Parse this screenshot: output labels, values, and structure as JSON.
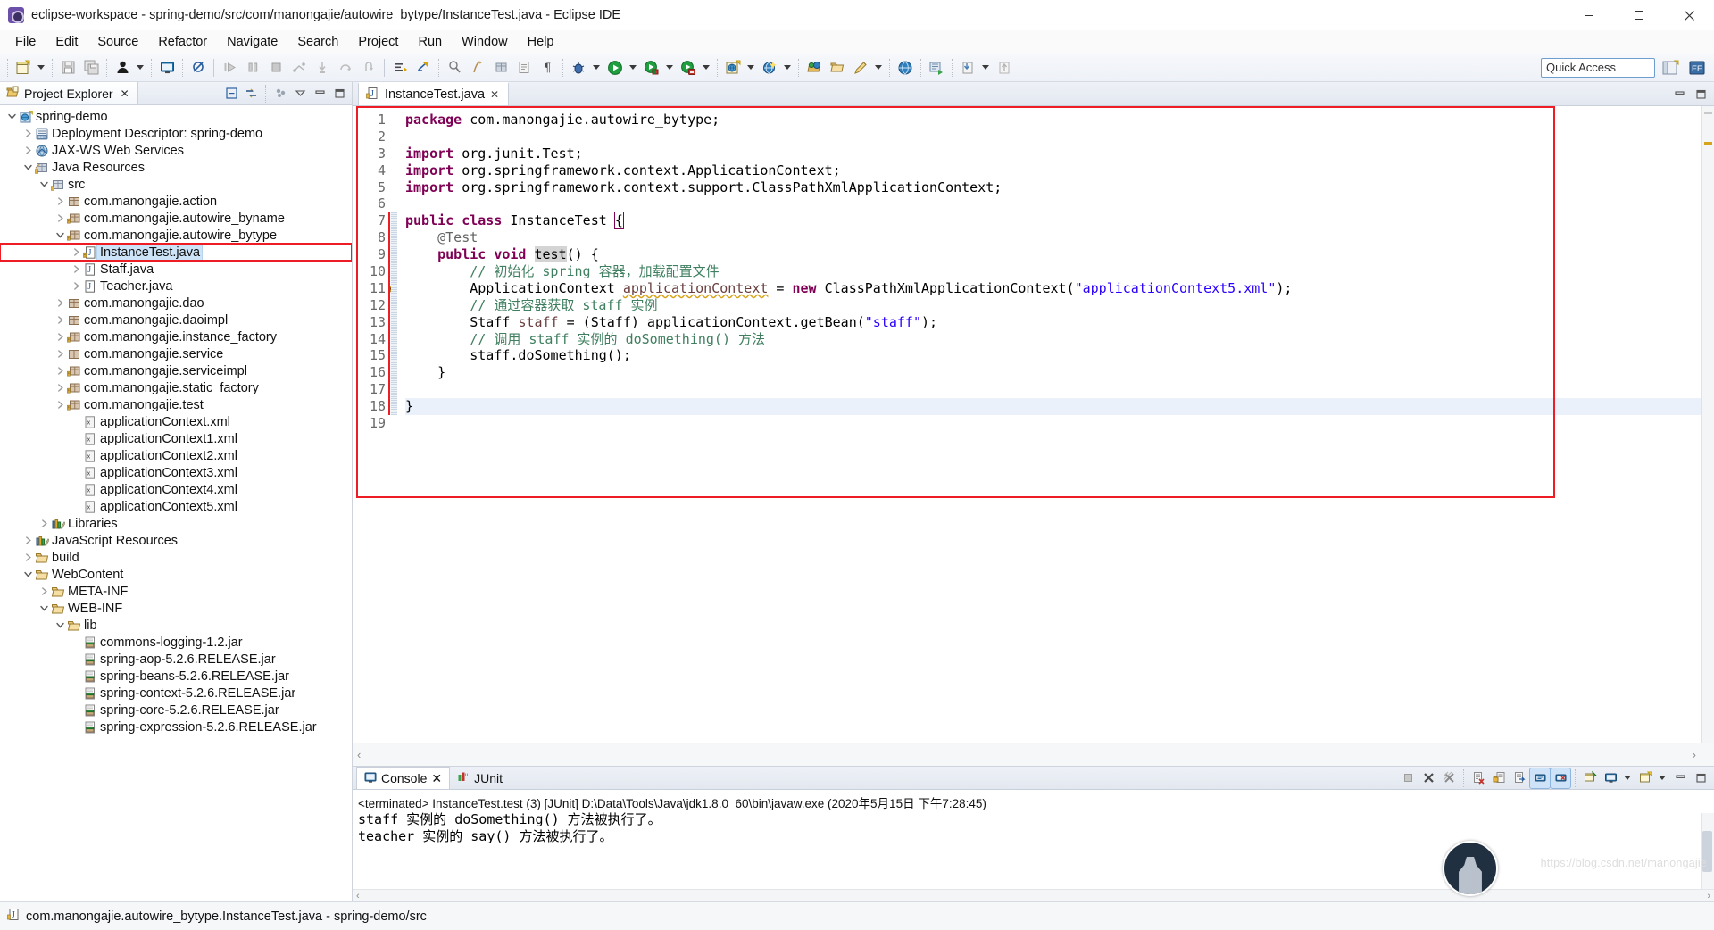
{
  "window": {
    "title": "eclipse-workspace - spring-demo/src/com/manongajie/autowire_bytype/InstanceTest.java - Eclipse IDE",
    "app_icon": "eclipse-icon",
    "minimize_label": "Minimize",
    "maximize_label": "Maximize",
    "close_label": "Close"
  },
  "menubar": {
    "items": [
      {
        "label": "File"
      },
      {
        "label": "Edit"
      },
      {
        "label": "Source"
      },
      {
        "label": "Refactor"
      },
      {
        "label": "Navigate"
      },
      {
        "label": "Search"
      },
      {
        "label": "Project"
      },
      {
        "label": "Run"
      },
      {
        "label": "Window"
      },
      {
        "label": "Help"
      }
    ]
  },
  "toolbar": {
    "quick_access_label": "Quick Access",
    "buttons": [
      {
        "name": "new-wizard",
        "icon": "new-file-icon"
      },
      {
        "name": "new-dropdown",
        "icon": "chevron-down-icon"
      },
      {
        "name": "save",
        "icon": "save-icon"
      },
      {
        "name": "save-all",
        "icon": "save-all-icon"
      },
      {
        "name": "user-profile",
        "icon": "person-icon"
      },
      {
        "name": "user-dropdown",
        "icon": "chevron-down-icon"
      },
      {
        "name": "new-console",
        "icon": "console-icon"
      },
      {
        "name": "skip-breakpoints",
        "icon": "skip-breakpoints-icon"
      },
      {
        "name": "resume",
        "icon": "resume-icon"
      },
      {
        "name": "suspend",
        "icon": "suspend-icon"
      },
      {
        "name": "terminate",
        "icon": "terminate-icon"
      },
      {
        "name": "disconnect",
        "icon": "disconnect-icon"
      },
      {
        "name": "step-into",
        "icon": "step-into-icon"
      },
      {
        "name": "step-over",
        "icon": "step-over-icon"
      },
      {
        "name": "step-return",
        "icon": "step-return-icon"
      },
      {
        "name": "next-annotation",
        "icon": "next-annotation-icon"
      },
      {
        "name": "previous-annotation",
        "icon": "previous-annotation-icon"
      },
      {
        "name": "toggle-mark-occurrences",
        "icon": "mark-occurrences-icon"
      },
      {
        "name": "new-java-project",
        "icon": "java-project-icon"
      },
      {
        "name": "new-package",
        "icon": "package-icon"
      },
      {
        "name": "open-type",
        "icon": "open-type-icon"
      },
      {
        "name": "show-whitespace",
        "icon": "pilcrow-icon"
      },
      {
        "name": "debug",
        "icon": "bug-icon"
      },
      {
        "name": "debug-dropdown",
        "icon": "chevron-down-icon"
      },
      {
        "name": "run",
        "icon": "run-icon"
      },
      {
        "name": "run-dropdown",
        "icon": "chevron-down-icon"
      },
      {
        "name": "run-as-server",
        "icon": "run-server-icon"
      },
      {
        "name": "run-server-dropdown",
        "icon": "chevron-down-icon"
      },
      {
        "name": "coverage",
        "icon": "coverage-icon"
      },
      {
        "name": "coverage-dropdown",
        "icon": "chevron-down-icon"
      },
      {
        "name": "new-dynamic-web-project",
        "icon": "web-project-icon"
      },
      {
        "name": "web-dropdown",
        "icon": "chevron-down-icon"
      },
      {
        "name": "search-resource",
        "icon": "search-sphere-icon"
      },
      {
        "name": "search-dropdown",
        "icon": "chevron-down-icon"
      },
      {
        "name": "open-perspective",
        "icon": "open-perspective-icon"
      },
      {
        "name": "open-folder",
        "icon": "folder-icon"
      },
      {
        "name": "edit-pencil",
        "icon": "pencil-icon"
      },
      {
        "name": "pencil-dropdown",
        "icon": "chevron-down-icon"
      },
      {
        "name": "open-web-browser",
        "icon": "globe-icon"
      },
      {
        "name": "run-last-tool",
        "icon": "external-tools-icon"
      },
      {
        "name": "import",
        "icon": "import-icon"
      },
      {
        "name": "import-dropdown",
        "icon": "chevron-down-icon"
      }
    ],
    "right_buttons": [
      {
        "name": "open-perspective-button",
        "icon": "open-perspective-icon"
      },
      {
        "name": "java-ee-perspective-button",
        "icon": "java-ee-perspective-icon"
      }
    ]
  },
  "explorer": {
    "tab_label": "Project Explorer",
    "tab_icon": "project-explorer-icon",
    "tab_close_icon": "close-icon",
    "tools": [
      {
        "name": "collapse-all-button",
        "icon": "collapse-all-icon"
      },
      {
        "name": "link-with-editor-button",
        "icon": "link-editor-icon"
      },
      {
        "name": "view-menu-filters-button",
        "icon": "filters-icon"
      },
      {
        "name": "view-menu-button",
        "icon": "chevron-down-icon"
      },
      {
        "name": "minimize-view-button",
        "icon": "minimize-icon"
      },
      {
        "name": "maximize-view-button",
        "icon": "maximize-icon"
      }
    ],
    "tree": [
      {
        "label": "spring-demo",
        "depth": 0,
        "twist": "down",
        "icon": "web-project-icon"
      },
      {
        "label": "Deployment Descriptor: spring-demo",
        "depth": 1,
        "twist": "right",
        "icon": "deployment-descriptor-icon"
      },
      {
        "label": "JAX-WS Web Services",
        "depth": 1,
        "twist": "right",
        "icon": "jaxws-icon"
      },
      {
        "label": "Java Resources",
        "depth": 1,
        "twist": "down",
        "icon": "java-resources-icon"
      },
      {
        "label": "src",
        "depth": 2,
        "twist": "down",
        "icon": "source-folder-icon"
      },
      {
        "label": "com.manongajie.action",
        "depth": 3,
        "twist": "right",
        "icon": "package-icon"
      },
      {
        "label": "com.manongajie.autowire_byname",
        "depth": 3,
        "twist": "right",
        "icon": "package-warning-icon"
      },
      {
        "label": "com.manongajie.autowire_bytype",
        "depth": 3,
        "twist": "down",
        "icon": "package-warning-icon"
      },
      {
        "label": "InstanceTest.java",
        "depth": 4,
        "twist": "right",
        "icon": "java-file-warning-icon",
        "selected": true,
        "highlight_box": true
      },
      {
        "label": "Staff.java",
        "depth": 4,
        "twist": "right",
        "icon": "java-file-icon"
      },
      {
        "label": "Teacher.java",
        "depth": 4,
        "twist": "right",
        "icon": "java-file-icon"
      },
      {
        "label": "com.manongajie.dao",
        "depth": 3,
        "twist": "right",
        "icon": "package-icon"
      },
      {
        "label": "com.manongajie.daoimpl",
        "depth": 3,
        "twist": "right",
        "icon": "package-icon"
      },
      {
        "label": "com.manongajie.instance_factory",
        "depth": 3,
        "twist": "right",
        "icon": "package-warning-icon"
      },
      {
        "label": "com.manongajie.service",
        "depth": 3,
        "twist": "right",
        "icon": "package-icon"
      },
      {
        "label": "com.manongajie.serviceimpl",
        "depth": 3,
        "twist": "right",
        "icon": "package-warning-icon"
      },
      {
        "label": "com.manongajie.static_factory",
        "depth": 3,
        "twist": "right",
        "icon": "package-warning-icon"
      },
      {
        "label": "com.manongajie.test",
        "depth": 3,
        "twist": "right",
        "icon": "package-warning-icon"
      },
      {
        "label": "applicationContext.xml",
        "depth": 4,
        "twist": "none",
        "icon": "xml-file-icon"
      },
      {
        "label": "applicationContext1.xml",
        "depth": 4,
        "twist": "none",
        "icon": "xml-file-icon"
      },
      {
        "label": "applicationContext2.xml",
        "depth": 4,
        "twist": "none",
        "icon": "xml-file-icon"
      },
      {
        "label": "applicationContext3.xml",
        "depth": 4,
        "twist": "none",
        "icon": "xml-file-icon"
      },
      {
        "label": "applicationContext4.xml",
        "depth": 4,
        "twist": "none",
        "icon": "xml-file-icon"
      },
      {
        "label": "applicationContext5.xml",
        "depth": 4,
        "twist": "none",
        "icon": "xml-file-icon"
      },
      {
        "label": "Libraries",
        "depth": 2,
        "twist": "right",
        "icon": "libraries-icon"
      },
      {
        "label": "JavaScript Resources",
        "depth": 1,
        "twist": "right",
        "icon": "libraries-icon"
      },
      {
        "label": "build",
        "depth": 1,
        "twist": "right",
        "icon": "folder-icon"
      },
      {
        "label": "WebContent",
        "depth": 1,
        "twist": "down",
        "icon": "folder-icon"
      },
      {
        "label": "META-INF",
        "depth": 2,
        "twist": "right",
        "icon": "folder-icon"
      },
      {
        "label": "WEB-INF",
        "depth": 2,
        "twist": "down",
        "icon": "folder-icon"
      },
      {
        "label": "lib",
        "depth": 3,
        "twist": "down",
        "icon": "folder-icon"
      },
      {
        "label": "commons-logging-1.2.jar",
        "depth": 4,
        "twist": "none",
        "icon": "jar-icon"
      },
      {
        "label": "spring-aop-5.2.6.RELEASE.jar",
        "depth": 4,
        "twist": "none",
        "icon": "jar-icon"
      },
      {
        "label": "spring-beans-5.2.6.RELEASE.jar",
        "depth": 4,
        "twist": "none",
        "icon": "jar-icon"
      },
      {
        "label": "spring-context-5.2.6.RELEASE.jar",
        "depth": 4,
        "twist": "none",
        "icon": "jar-icon"
      },
      {
        "label": "spring-core-5.2.6.RELEASE.jar",
        "depth": 4,
        "twist": "none",
        "icon": "jar-icon"
      },
      {
        "label": "spring-expression-5.2.6.RELEASE.jar",
        "depth": 4,
        "twist": "none",
        "icon": "jar-icon"
      }
    ]
  },
  "editor": {
    "tab_label": "InstanceTest.java",
    "tab_icon": "java-file-warning-icon",
    "tab_close_icon": "close-icon",
    "tools": [
      {
        "name": "minimize-editor-button",
        "icon": "minimize-icon"
      },
      {
        "name": "maximize-editor-button",
        "icon": "maximize-icon"
      }
    ],
    "scroll_left_icon": "chevron-left-icon",
    "scroll_right_icon": "chevron-right-icon",
    "lines": [
      {
        "n": "1",
        "fold": false,
        "warn": false,
        "current": false
      },
      {
        "n": "2",
        "fold": false,
        "warn": false,
        "current": false
      },
      {
        "n": "3",
        "fold": true,
        "warn": false,
        "current": false
      },
      {
        "n": "4",
        "fold": false,
        "warn": false,
        "current": false
      },
      {
        "n": "5",
        "fold": false,
        "warn": false,
        "current": false
      },
      {
        "n": "6",
        "fold": false,
        "warn": false,
        "current": false
      },
      {
        "n": "7",
        "fold": false,
        "warn": false,
        "current": false
      },
      {
        "n": "8",
        "fold": true,
        "warn": false,
        "current": false
      },
      {
        "n": "9",
        "fold": false,
        "warn": false,
        "current": false
      },
      {
        "n": "10",
        "fold": false,
        "warn": false,
        "current": false
      },
      {
        "n": "11",
        "fold": false,
        "warn": true,
        "current": false
      },
      {
        "n": "12",
        "fold": false,
        "warn": false,
        "current": false
      },
      {
        "n": "13",
        "fold": false,
        "warn": false,
        "current": false
      },
      {
        "n": "14",
        "fold": false,
        "warn": false,
        "current": false
      },
      {
        "n": "15",
        "fold": false,
        "warn": false,
        "current": false
      },
      {
        "n": "16",
        "fold": false,
        "warn": false,
        "current": false
      },
      {
        "n": "17",
        "fold": false,
        "warn": false,
        "current": false
      },
      {
        "n": "18",
        "fold": false,
        "warn": false,
        "current": true
      },
      {
        "n": "19",
        "fold": false,
        "warn": false,
        "current": false
      }
    ],
    "source_text": [
      "package com.manongajie.autowire_bytype;",
      "",
      "import org.junit.Test;",
      "import org.springframework.context.ApplicationContext;",
      "import org.springframework.context.support.ClassPathXmlApplicationContext;",
      "",
      "public class InstanceTest {",
      "    @Test",
      "    public void test() {",
      "        // 初始化 spring 容器，加载配置文件",
      "        ApplicationContext applicationContext = new ClassPathXmlApplicationContext(\"applicationContext5.xml\");",
      "        // 通过容器获取 staff 实例",
      "        Staff staff = (Staff) applicationContext.getBean(\"staff\");",
      "        // 调用 staff 实例的 doSomething() 方法",
      "        staff.doSomething();",
      "    }",
      "",
      "}",
      ""
    ]
  },
  "console": {
    "tabs": [
      {
        "label": "Console",
        "icon": "console-icon",
        "active": true,
        "close_icon": "close-icon"
      },
      {
        "label": "JUnit",
        "icon": "junit-icon",
        "active": false
      }
    ],
    "tools": [
      {
        "name": "terminate-button",
        "icon": "terminate-icon"
      },
      {
        "name": "remove-launch-button",
        "icon": "remove-icon"
      },
      {
        "name": "remove-all-terminated-button",
        "icon": "remove-all-icon"
      },
      {
        "name": "clear-console-button",
        "icon": "clear-console-icon"
      },
      {
        "name": "scroll-lock-button",
        "icon": "scroll-lock-icon"
      },
      {
        "name": "word-wrap-button",
        "icon": "word-wrap-icon"
      },
      {
        "name": "show-console-on-output-button",
        "icon": "show-on-output-icon",
        "toggled": true
      },
      {
        "name": "show-console-on-error-button",
        "icon": "show-on-error-icon",
        "toggled": true
      },
      {
        "name": "pin-console-button",
        "icon": "pin-icon"
      },
      {
        "name": "display-selected-console-button",
        "icon": "display-console-icon"
      },
      {
        "name": "display-console-dropdown",
        "icon": "chevron-down-icon"
      },
      {
        "name": "open-console-button",
        "icon": "open-console-icon"
      },
      {
        "name": "open-console-dropdown",
        "icon": "chevron-down-icon"
      },
      {
        "name": "minimize-console-button",
        "icon": "minimize-icon"
      },
      {
        "name": "maximize-console-button",
        "icon": "maximize-icon"
      }
    ],
    "header_line": "<terminated> InstanceTest.test (3) [JUnit] D:\\Data\\Tools\\Java\\jdk1.8.0_60\\bin\\javaw.exe (2020年5月15日 下午7:28:45)",
    "output_lines": [
      "staff 实例的 doSomething() 方法被执行了。",
      "teacher 实例的 say() 方法被执行了。"
    ],
    "scroll_left_icon": "chevron-left-icon",
    "scroll_right_icon": "chevron-right-icon"
  },
  "statusbar": {
    "icon": "java-file-warning-icon",
    "text": "com.manongajie.autowire_bytype.InstanceTest.java - spring-demo/src"
  },
  "watermark": {
    "text": "https://blog.csdn.net/manongajie"
  },
  "colors": {
    "accent_red": "#ee1c24",
    "keyword": "#7f0055",
    "comment": "#3f7f5f",
    "string": "#2a00ff",
    "selection": "#cde3f7",
    "current_line": "#eaf1fb"
  }
}
